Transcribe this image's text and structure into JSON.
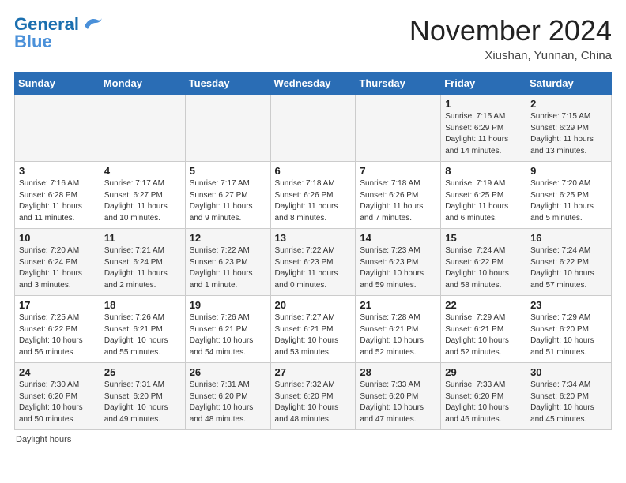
{
  "header": {
    "logo_line1": "General",
    "logo_line2": "Blue",
    "month_title": "November 2024",
    "location": "Xiushan, Yunnan, China"
  },
  "footer": {
    "note": "Daylight hours"
  },
  "weekdays": [
    "Sunday",
    "Monday",
    "Tuesday",
    "Wednesday",
    "Thursday",
    "Friday",
    "Saturday"
  ],
  "weeks": [
    {
      "days": [
        {
          "num": "",
          "info": ""
        },
        {
          "num": "",
          "info": ""
        },
        {
          "num": "",
          "info": ""
        },
        {
          "num": "",
          "info": ""
        },
        {
          "num": "",
          "info": ""
        },
        {
          "num": "1",
          "info": "Sunrise: 7:15 AM\nSunset: 6:29 PM\nDaylight: 11 hours\nand 14 minutes."
        },
        {
          "num": "2",
          "info": "Sunrise: 7:15 AM\nSunset: 6:29 PM\nDaylight: 11 hours\nand 13 minutes."
        }
      ]
    },
    {
      "days": [
        {
          "num": "3",
          "info": "Sunrise: 7:16 AM\nSunset: 6:28 PM\nDaylight: 11 hours\nand 11 minutes."
        },
        {
          "num": "4",
          "info": "Sunrise: 7:17 AM\nSunset: 6:27 PM\nDaylight: 11 hours\nand 10 minutes."
        },
        {
          "num": "5",
          "info": "Sunrise: 7:17 AM\nSunset: 6:27 PM\nDaylight: 11 hours\nand 9 minutes."
        },
        {
          "num": "6",
          "info": "Sunrise: 7:18 AM\nSunset: 6:26 PM\nDaylight: 11 hours\nand 8 minutes."
        },
        {
          "num": "7",
          "info": "Sunrise: 7:18 AM\nSunset: 6:26 PM\nDaylight: 11 hours\nand 7 minutes."
        },
        {
          "num": "8",
          "info": "Sunrise: 7:19 AM\nSunset: 6:25 PM\nDaylight: 11 hours\nand 6 minutes."
        },
        {
          "num": "9",
          "info": "Sunrise: 7:20 AM\nSunset: 6:25 PM\nDaylight: 11 hours\nand 5 minutes."
        }
      ]
    },
    {
      "days": [
        {
          "num": "10",
          "info": "Sunrise: 7:20 AM\nSunset: 6:24 PM\nDaylight: 11 hours\nand 3 minutes."
        },
        {
          "num": "11",
          "info": "Sunrise: 7:21 AM\nSunset: 6:24 PM\nDaylight: 11 hours\nand 2 minutes."
        },
        {
          "num": "12",
          "info": "Sunrise: 7:22 AM\nSunset: 6:23 PM\nDaylight: 11 hours\nand 1 minute."
        },
        {
          "num": "13",
          "info": "Sunrise: 7:22 AM\nSunset: 6:23 PM\nDaylight: 11 hours\nand 0 minutes."
        },
        {
          "num": "14",
          "info": "Sunrise: 7:23 AM\nSunset: 6:23 PM\nDaylight: 10 hours\nand 59 minutes."
        },
        {
          "num": "15",
          "info": "Sunrise: 7:24 AM\nSunset: 6:22 PM\nDaylight: 10 hours\nand 58 minutes."
        },
        {
          "num": "16",
          "info": "Sunrise: 7:24 AM\nSunset: 6:22 PM\nDaylight: 10 hours\nand 57 minutes."
        }
      ]
    },
    {
      "days": [
        {
          "num": "17",
          "info": "Sunrise: 7:25 AM\nSunset: 6:22 PM\nDaylight: 10 hours\nand 56 minutes."
        },
        {
          "num": "18",
          "info": "Sunrise: 7:26 AM\nSunset: 6:21 PM\nDaylight: 10 hours\nand 55 minutes."
        },
        {
          "num": "19",
          "info": "Sunrise: 7:26 AM\nSunset: 6:21 PM\nDaylight: 10 hours\nand 54 minutes."
        },
        {
          "num": "20",
          "info": "Sunrise: 7:27 AM\nSunset: 6:21 PM\nDaylight: 10 hours\nand 53 minutes."
        },
        {
          "num": "21",
          "info": "Sunrise: 7:28 AM\nSunset: 6:21 PM\nDaylight: 10 hours\nand 52 minutes."
        },
        {
          "num": "22",
          "info": "Sunrise: 7:29 AM\nSunset: 6:21 PM\nDaylight: 10 hours\nand 52 minutes."
        },
        {
          "num": "23",
          "info": "Sunrise: 7:29 AM\nSunset: 6:20 PM\nDaylight: 10 hours\nand 51 minutes."
        }
      ]
    },
    {
      "days": [
        {
          "num": "24",
          "info": "Sunrise: 7:30 AM\nSunset: 6:20 PM\nDaylight: 10 hours\nand 50 minutes."
        },
        {
          "num": "25",
          "info": "Sunrise: 7:31 AM\nSunset: 6:20 PM\nDaylight: 10 hours\nand 49 minutes."
        },
        {
          "num": "26",
          "info": "Sunrise: 7:31 AM\nSunset: 6:20 PM\nDaylight: 10 hours\nand 48 minutes."
        },
        {
          "num": "27",
          "info": "Sunrise: 7:32 AM\nSunset: 6:20 PM\nDaylight: 10 hours\nand 48 minutes."
        },
        {
          "num": "28",
          "info": "Sunrise: 7:33 AM\nSunset: 6:20 PM\nDaylight: 10 hours\nand 47 minutes."
        },
        {
          "num": "29",
          "info": "Sunrise: 7:33 AM\nSunset: 6:20 PM\nDaylight: 10 hours\nand 46 minutes."
        },
        {
          "num": "30",
          "info": "Sunrise: 7:34 AM\nSunset: 6:20 PM\nDaylight: 10 hours\nand 45 minutes."
        }
      ]
    }
  ]
}
